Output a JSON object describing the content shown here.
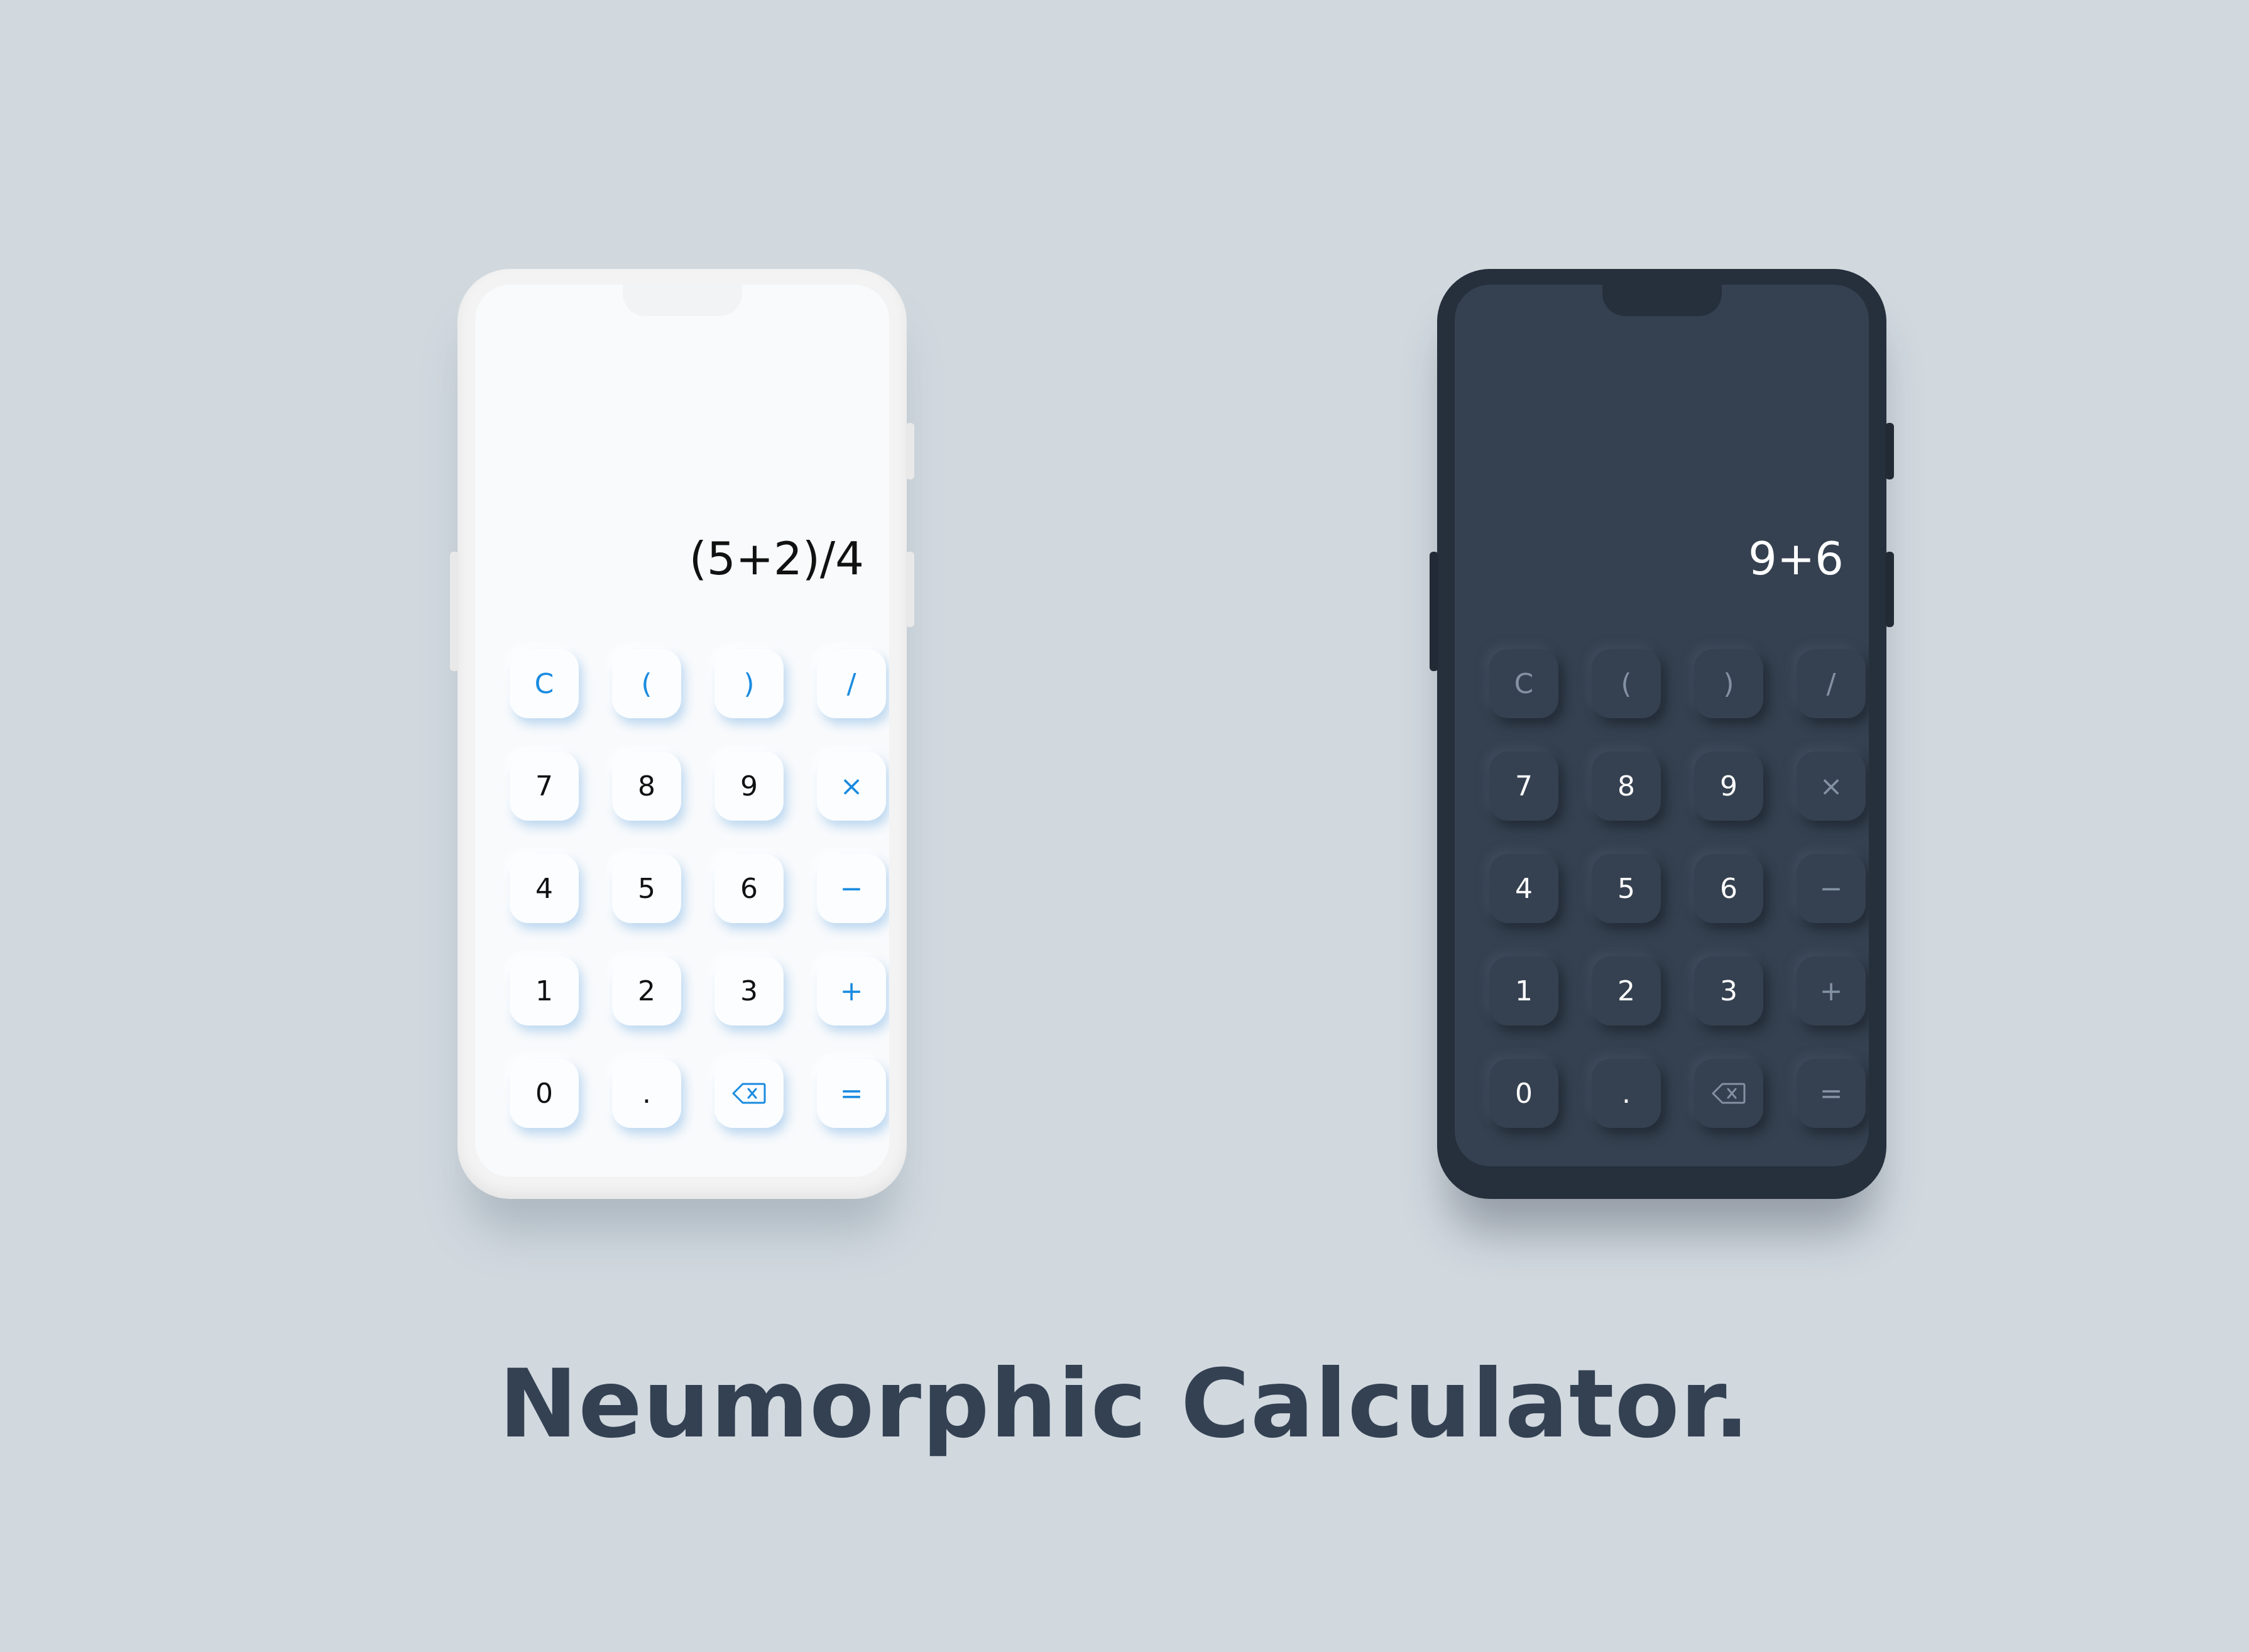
{
  "title": "Neumorphic Calculator.",
  "colors": {
    "background": "#d1d9df",
    "title": "#344153",
    "light_accent": "#1a8be0",
    "dark_screen": "#354150",
    "dark_accent": "#8391a3"
  },
  "light_phone": {
    "expression": "(5+2)/4",
    "keys": [
      {
        "label": "C"
      },
      {
        "label": "("
      },
      {
        "label": ")"
      },
      {
        "label": "/"
      },
      {
        "label": "7"
      },
      {
        "label": "8"
      },
      {
        "label": "9"
      },
      {
        "label": "×"
      },
      {
        "label": "4"
      },
      {
        "label": "5"
      },
      {
        "label": "6"
      },
      {
        "label": "−"
      },
      {
        "label": "1"
      },
      {
        "label": "2"
      },
      {
        "label": "3"
      },
      {
        "label": "+"
      },
      {
        "label": "0"
      },
      {
        "label": "."
      },
      {
        "icon": "backspace-icon"
      },
      {
        "label": "="
      }
    ]
  },
  "dark_phone": {
    "expression": "9+6",
    "keys": [
      {
        "label": "C"
      },
      {
        "label": "("
      },
      {
        "label": ")"
      },
      {
        "label": "/"
      },
      {
        "label": "7"
      },
      {
        "label": "8"
      },
      {
        "label": "9"
      },
      {
        "label": "×"
      },
      {
        "label": "4"
      },
      {
        "label": "5"
      },
      {
        "label": "6"
      },
      {
        "label": "−"
      },
      {
        "label": "1"
      },
      {
        "label": "2"
      },
      {
        "label": "3"
      },
      {
        "label": "+"
      },
      {
        "label": "0"
      },
      {
        "label": "."
      },
      {
        "icon": "backspace-icon"
      },
      {
        "label": "="
      }
    ]
  }
}
